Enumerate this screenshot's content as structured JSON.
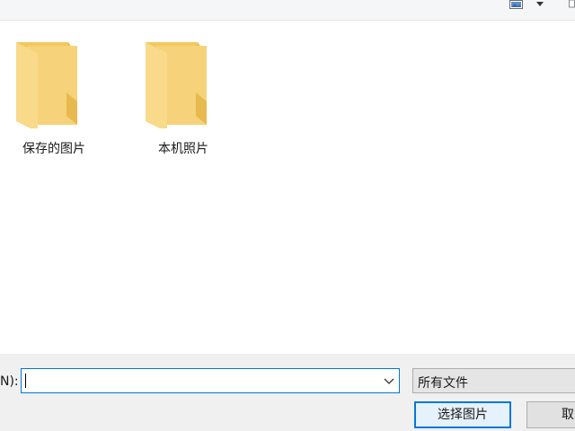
{
  "toolbar": {
    "view_icon": "picture-view-icon",
    "dropdown_icon": "caret-down-icon"
  },
  "folders": [
    {
      "label": "保存的图片",
      "icon": "folder-icon"
    },
    {
      "label": "本机照片",
      "icon": "folder-icon"
    }
  ],
  "footer": {
    "filename_label": "N):",
    "filename_value": "",
    "filetype_value": "所有文件",
    "select_label": "选择图片",
    "cancel_label": "取"
  },
  "colors": {
    "accent": "#0078d7",
    "folder_back": "#e8b84a",
    "folder_front": "#f9d77a",
    "panel_bg": "#f0f0f0"
  }
}
